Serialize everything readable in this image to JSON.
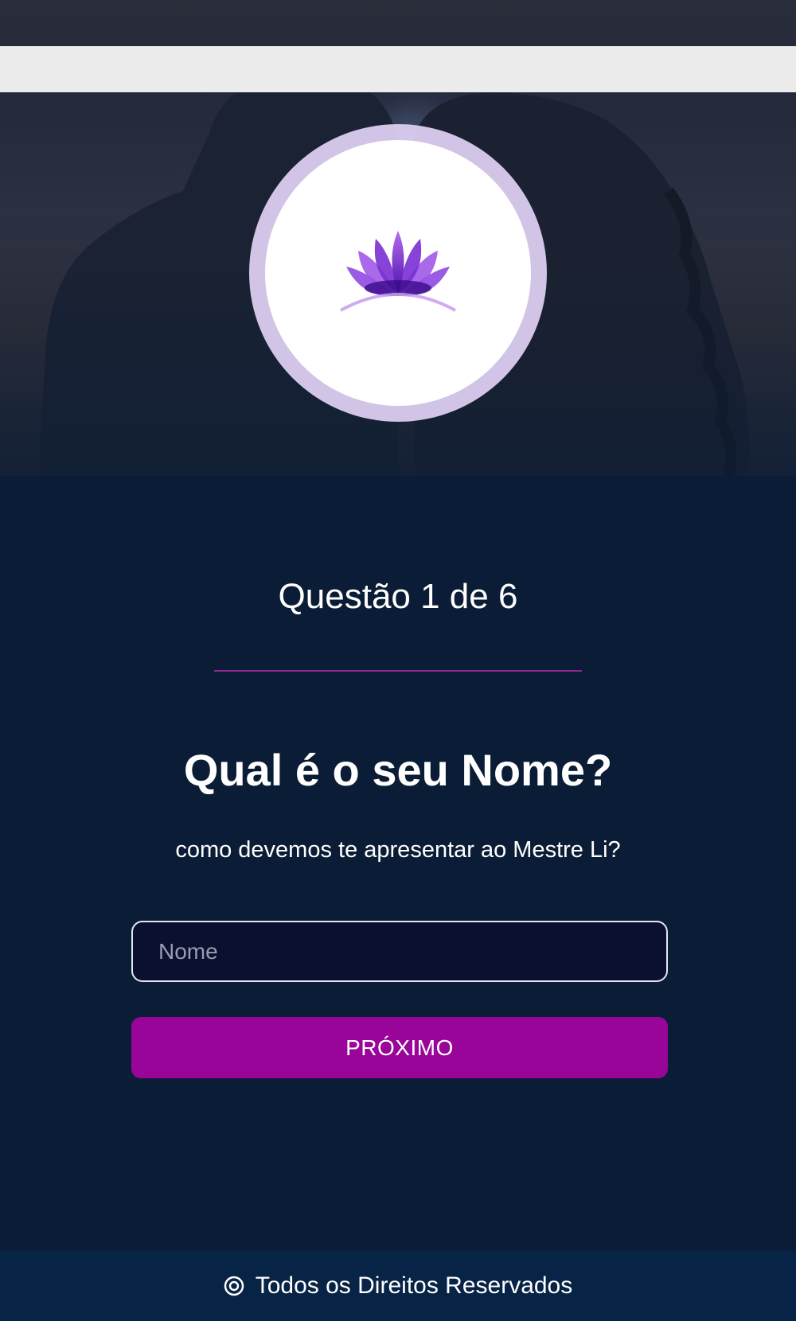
{
  "header": {
    "logo_icon": "lotus-icon",
    "colors": {
      "logo_primary": "#6a1fc4",
      "logo_secondary": "#9b59e8"
    }
  },
  "quiz": {
    "counter": "Questão 1 de 6",
    "current_question": 1,
    "total_questions": 6,
    "question": "Qual é o seu Nome?",
    "subtitle": "como devemos te apresentar ao Mestre Li?",
    "name_input": {
      "value": "",
      "placeholder": "Nome"
    },
    "next_label": "PRÓXIMO"
  },
  "footer": {
    "icon": "copyright-icon",
    "text": "Todos os Direitos Reservados"
  },
  "colors": {
    "background": "#0b1d36",
    "accent": "#980598",
    "divider": "#8e2a8e",
    "footer_background": "#072345",
    "input_background": "#0a1130"
  }
}
